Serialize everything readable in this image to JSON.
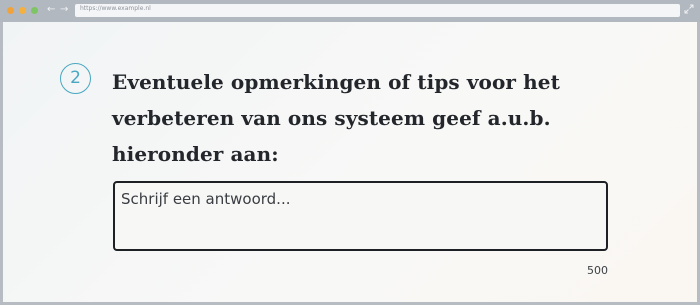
{
  "browser": {
    "url": "https://www.example.nl"
  },
  "question": {
    "number": "2",
    "text": "Eventuele opmerkingen of tips voor het verbeteren van ons systeem geef a.u.b. hieronder aan:"
  },
  "answer": {
    "placeholder": "Schrijf een antwoord...",
    "value": "",
    "char_limit": "500"
  },
  "colors": {
    "accent": "#49a7c1",
    "text": "#23262b",
    "border": "#1d2024"
  }
}
